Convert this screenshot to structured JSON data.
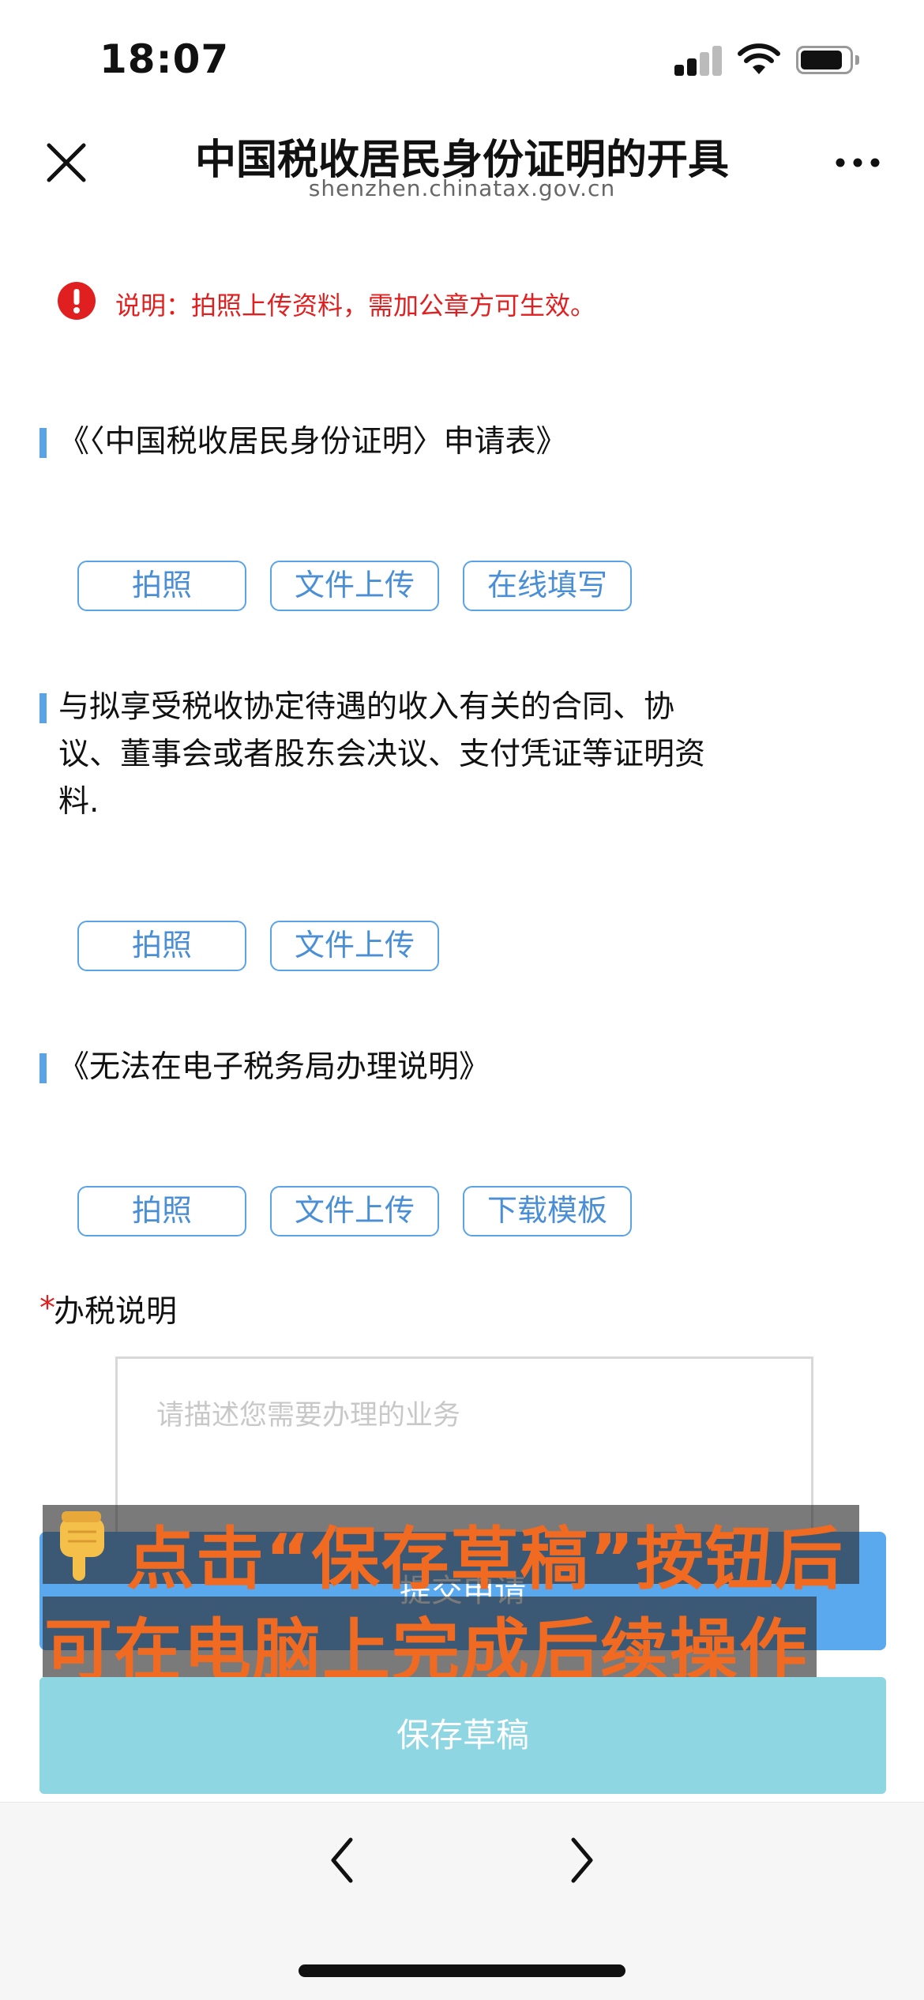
{
  "status_bar": {
    "time": "18:07"
  },
  "header": {
    "title": "中国税收居民身份证明的开具",
    "subtitle": "shenzhen.chinatax.gov.cn",
    "close_icon": "close-icon",
    "more_icon": "more-icon"
  },
  "notice": {
    "icon": "error-icon",
    "text": "说明：拍照上传资料，需加公章方可生效。"
  },
  "sections": [
    {
      "title": "《〈中国税收居民身份证明〉申请表》",
      "buttons": [
        "拍照",
        "文件上传",
        "在线填写"
      ]
    },
    {
      "title_lines": [
        "与拟享受税收协定待遇的收入有关的合同、协",
        "议、董事会或者股东会决议、支付凭证等证明资",
        "料."
      ],
      "buttons": [
        "拍照",
        "文件上传"
      ]
    },
    {
      "title": "《无法在电子税务局办理说明》",
      "buttons": [
        "拍照",
        "文件上传",
        "下载模板"
      ]
    }
  ],
  "form": {
    "required_mark": "*",
    "label": "办税说明",
    "placeholder": "请描述您需要办理的业务"
  },
  "actions": {
    "submit_label": "提交申请",
    "save_label": "保存草稿"
  },
  "overlay": {
    "line1": "点击“保存草稿”按钮后",
    "line2": "可在电脑上完成后续操作",
    "icon": "pointing-down-hand-icon"
  },
  "bottom_nav": {
    "back_icon": "chevron-left-icon",
    "forward_icon": "chevron-right-icon"
  },
  "colors": {
    "accent": "#5aa3e6",
    "warning": "#e02020",
    "save_button": "#8fd6e3",
    "overlay_text": "#f06a22"
  }
}
